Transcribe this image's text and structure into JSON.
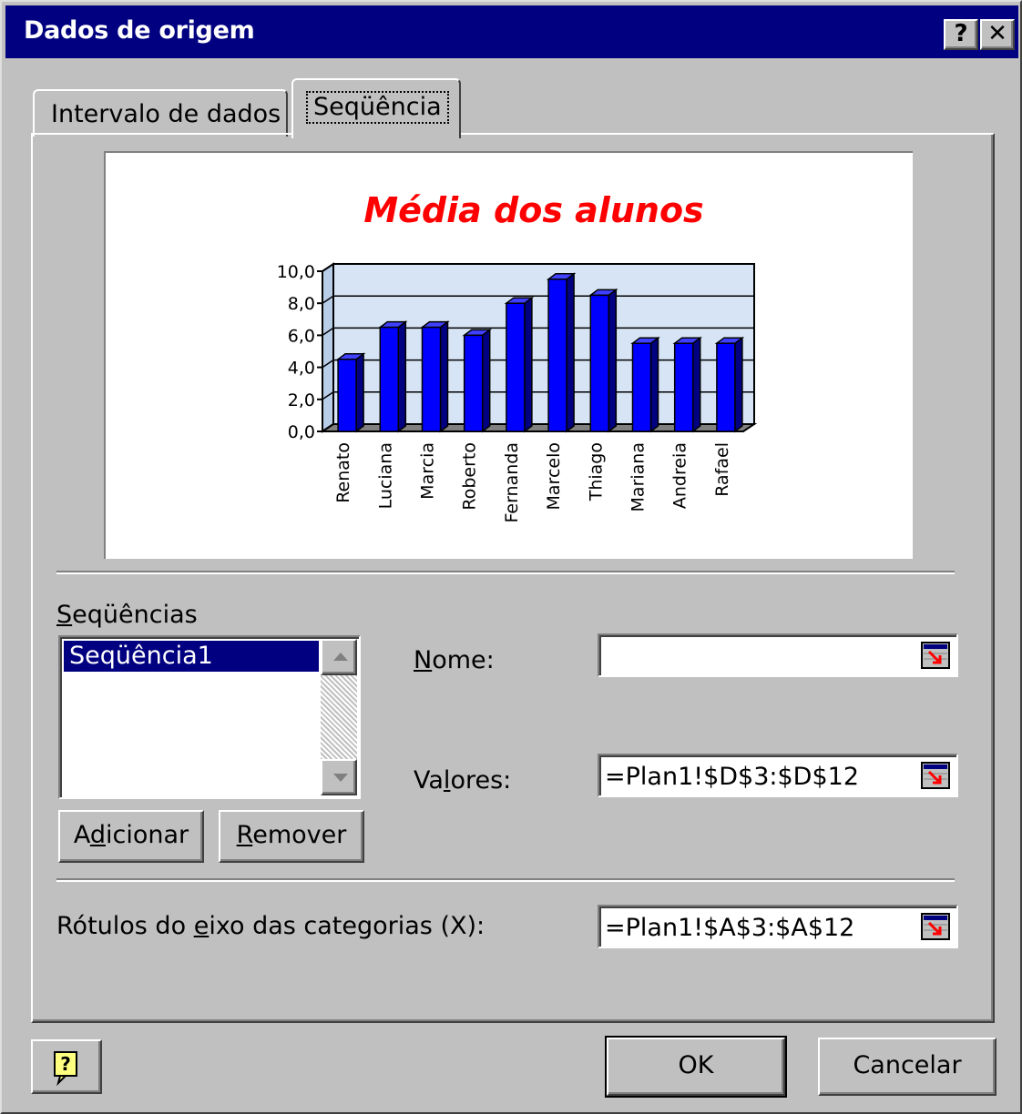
{
  "window": {
    "title": "Dados de origem"
  },
  "titlebar": {
    "help_label": "?",
    "close_label": "✕"
  },
  "tabs": [
    {
      "label": "Intervalo de dados",
      "active": false
    },
    {
      "label": "Seqüência",
      "active": true
    }
  ],
  "chart_data": {
    "type": "bar",
    "title": "Média dos alunos",
    "categories": [
      "Renato",
      "Luciana",
      "Marcia",
      "Roberto",
      "Fernanda",
      "Marcelo",
      "Thiago",
      "Mariana",
      "Andreia",
      "Rafael"
    ],
    "series": [
      {
        "values": [
          4.5,
          6.5,
          6.5,
          6.0,
          8.0,
          9.5,
          8.5,
          5.5,
          5.5,
          5.5
        ]
      }
    ],
    "ylim": [
      0,
      10
    ],
    "y_ticks": [
      "0,0",
      "2,0",
      "4,0",
      "6,0",
      "8,0",
      "10,0"
    ],
    "bar_color": "#0000ff",
    "title_color": "#ff0000",
    "wall_color": "#d6e4f5",
    "grid": true,
    "style": "3d-column"
  },
  "series_section": {
    "label_prefix": "",
    "label_u": "S",
    "label_rest": "eqüências",
    "items": [
      "Seqüência1"
    ],
    "selected": "Seqüência1",
    "add_pre": "A",
    "add_u": "d",
    "add_post": "icionar",
    "remove_u": "R",
    "remove_post": "emover"
  },
  "fields": {
    "nome": {
      "label_u": "N",
      "label_rest": "ome:",
      "value": ""
    },
    "valores": {
      "label_pre": "Va",
      "label_u": "l",
      "label_rest": "ores:",
      "value": "=Plan1!$D$3:$D$12"
    },
    "rotulos": {
      "label_pre": "Rótulos do ",
      "label_u": "e",
      "label_rest": "ixo das categorias (X):",
      "value": "=Plan1!$A$3:$A$12"
    }
  },
  "footer": {
    "help_icon_label": "?",
    "ok_label": "OK",
    "cancel_label": "Cancelar"
  }
}
